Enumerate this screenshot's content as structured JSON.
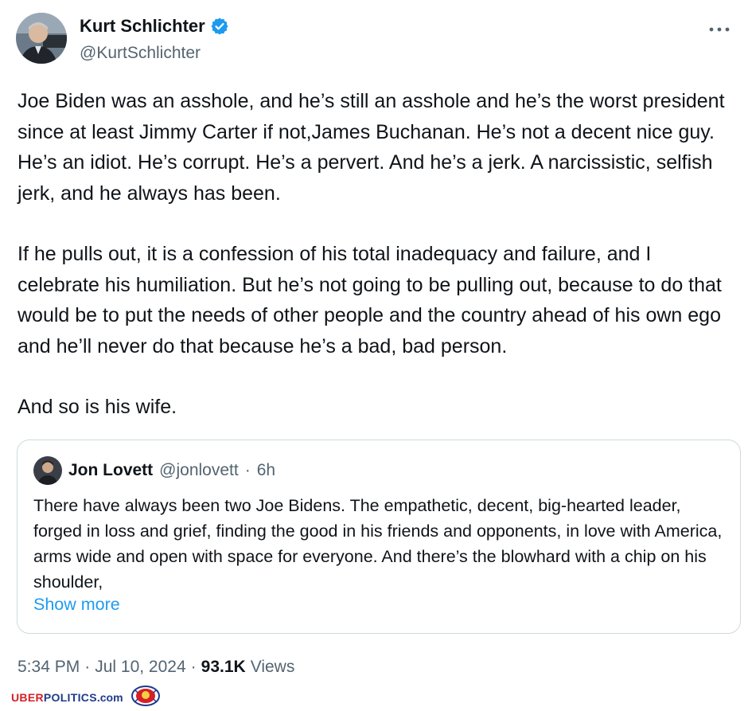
{
  "author": {
    "name": "Kurt Schlichter",
    "handle": "@KurtSchlichter",
    "verified": true,
    "badge_color": "#1d9bf0"
  },
  "menu_icon": "more-horizontal-icon",
  "tweet": {
    "paragraphs": [
      "Joe Biden was an asshole, and he’s still an asshole and he’s the worst president since at least Jimmy Carter if not,James Buchanan. He’s not a decent nice guy. He’s an idiot. He’s corrupt. He’s a pervert. And he’s a jerk. A narcissistic, selfish jerk, and he always has been.",
      "If he pulls out, it is a confession of his total inadequacy and failure, and I celebrate his humiliation. But he’s not going to be pulling out, because to do that would be to put the needs of other people and the country ahead of his own ego and he’ll never do that because he’s a bad, bad person.",
      "And so is his wife."
    ]
  },
  "quote": {
    "name": "Jon Lovett",
    "handle": "@jonlovett",
    "separator": "·",
    "time": "6h",
    "text": "There have always been two Joe Bidens. The empathetic, decent, big-hearted leader, forged in loss and grief, finding the good in his friends and opponents, in love with America, arms wide and open with space for everyone. And there’s the blowhard with a chip on his shoulder,",
    "show_more": "Show more"
  },
  "meta": {
    "time": "5:34 PM",
    "sep1": "·",
    "date": "Jul 10, 2024",
    "sep2": "·",
    "views_count": "93.1K",
    "views_label": "Views"
  },
  "watermark": {
    "part1": "UBER",
    "part2": "POLITICS",
    "part3": ".com"
  }
}
